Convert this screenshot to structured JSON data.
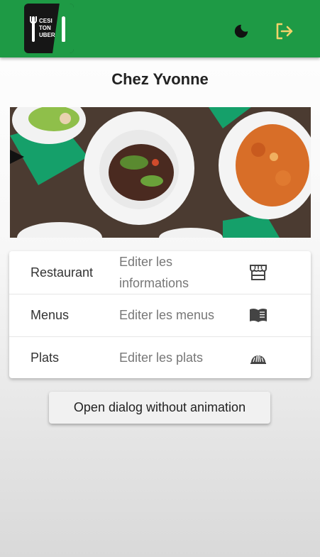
{
  "header": {
    "logo_text": [
      "CESI",
      "TON",
      "UBER"
    ],
    "theme_icon": "moon-icon",
    "logout_icon": "logout-icon",
    "brand_color": "#1e9a45"
  },
  "restaurant": {
    "name": "Chez Yvonne"
  },
  "settings": [
    {
      "label": "Restaurant",
      "description": "Editer les informations",
      "icon": "store-icon"
    },
    {
      "label": "Menus",
      "description": "Editer les menus",
      "icon": "menu-book-icon"
    },
    {
      "label": "Plats",
      "description": "Editer les plats",
      "icon": "dish-icon"
    }
  ],
  "dialog_button": {
    "label": "Open dialog without animation"
  }
}
